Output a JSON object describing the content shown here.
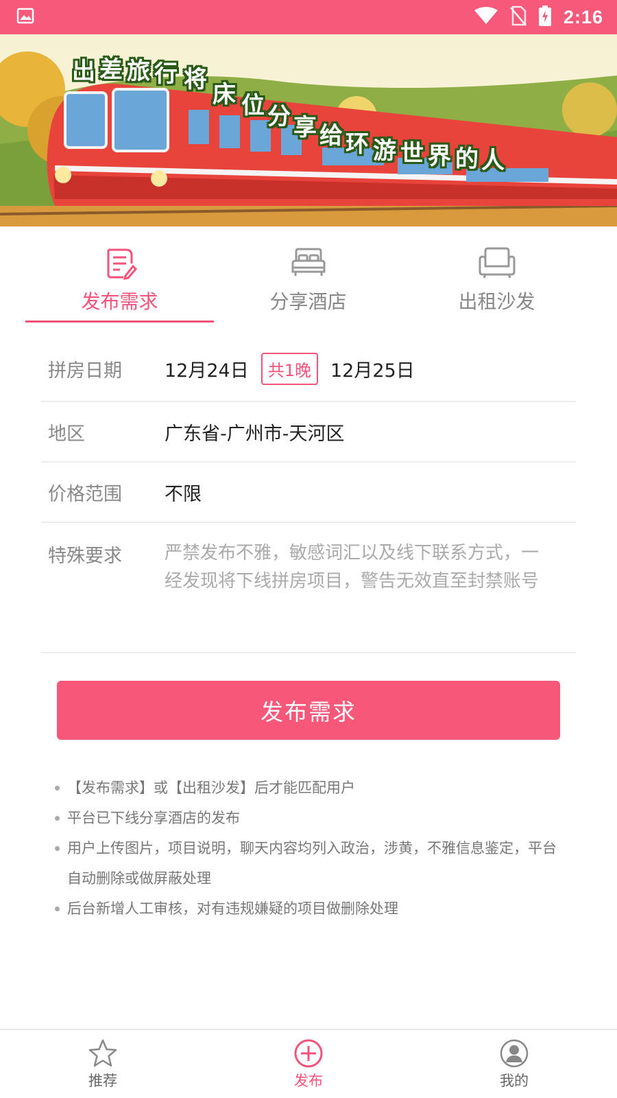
{
  "status_bar": {
    "time": "2:16",
    "icons": [
      "image-icon",
      "wifi-icon",
      "no-sim-icon",
      "battery-charging-icon"
    ]
  },
  "banner": {
    "slogan": [
      "出",
      "差",
      "旅",
      "行",
      "将",
      "床",
      "位",
      "分",
      "享",
      "给",
      "环",
      "游",
      "世",
      "界",
      "的",
      "人"
    ]
  },
  "tabs": [
    {
      "label": "发布需求",
      "icon": "edit-note-icon",
      "active": true
    },
    {
      "label": "分享酒店",
      "icon": "bed-icon",
      "active": false
    },
    {
      "label": "出租沙发",
      "icon": "sofa-icon",
      "active": false
    }
  ],
  "form": {
    "date": {
      "label": "拼房日期",
      "start": "12月24日",
      "nights": "共1晚",
      "end": "12月25日"
    },
    "region": {
      "label": "地区",
      "value": "广东省-广州市-天河区"
    },
    "price": {
      "label": "价格范围",
      "value": "不限"
    },
    "special": {
      "label": "特殊要求",
      "placeholder": "严禁发布不雅，敏感词汇以及线下联系方式，一经发现将下线拼房项目，警告无效直至封禁账号"
    }
  },
  "submit_label": "发布需求",
  "notes": [
    "【发布需求】或【出租沙发】后才能匹配用户",
    "平台已下线分享酒店的发布",
    "用户上传图片，项目说明，聊天内容均列入政治，涉黄，不雅信息鉴定，平台自动删除或做屏蔽处理",
    "后台新增人工审核，对有违规嫌疑的项目做删除处理"
  ],
  "bottom_nav": [
    {
      "label": "推荐",
      "icon": "star-icon",
      "active": false
    },
    {
      "label": "发布",
      "icon": "plus-circle-icon",
      "active": true
    },
    {
      "label": "我的",
      "icon": "user-icon",
      "active": false
    }
  ],
  "colors": {
    "accent": "#f7587a",
    "status_bar": "#f7597a",
    "muted": "#888888"
  }
}
